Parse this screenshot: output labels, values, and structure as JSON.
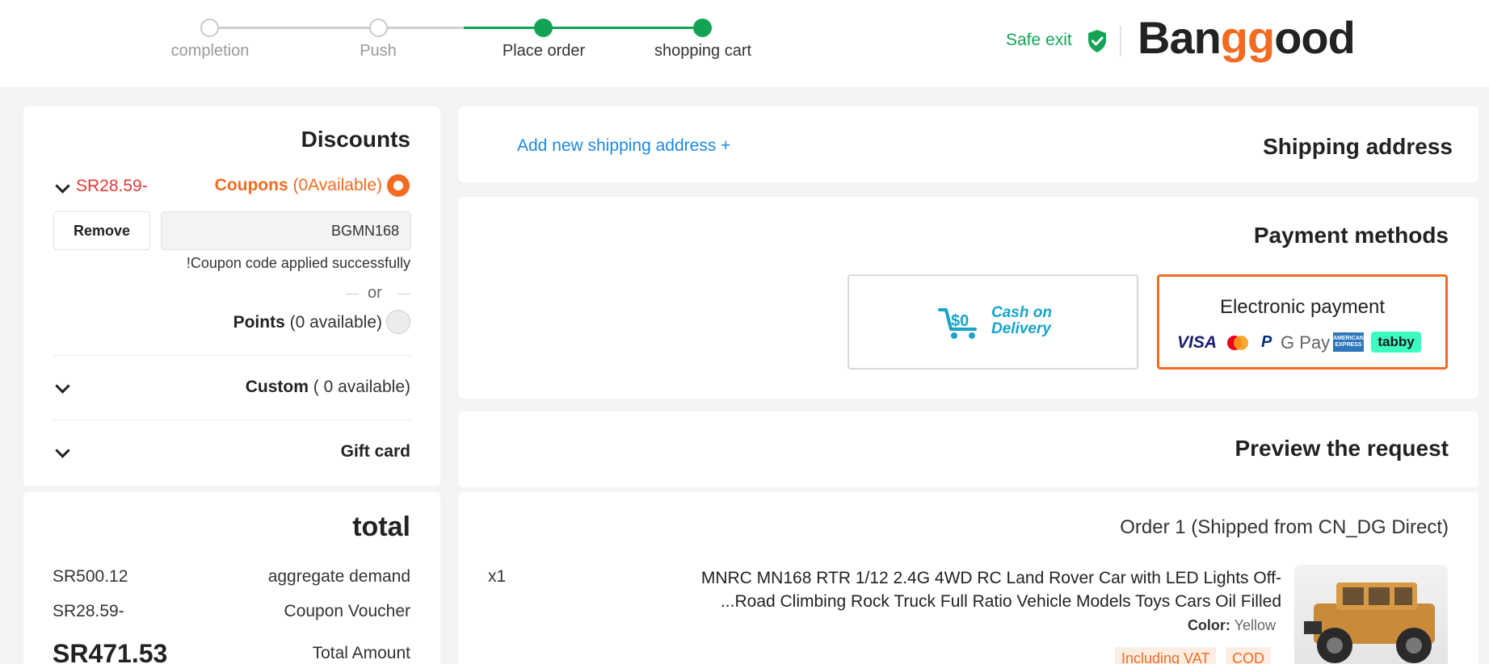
{
  "header": {
    "steps": [
      {
        "label": "completion",
        "active": false
      },
      {
        "label": "Push",
        "active": false
      },
      {
        "label": "Place order",
        "active": true
      },
      {
        "label": "shopping cart",
        "active": true
      }
    ],
    "safe_exit": "Safe exit",
    "logo": {
      "part1": "Ban",
      "part2": "gg",
      "part3": "ood"
    }
  },
  "discounts": {
    "title": "Discounts",
    "coupons": {
      "amount": "SR28.59-",
      "label": "Coupons",
      "available": "(0Available)",
      "selected": true
    },
    "remove_label": "Remove",
    "code_value": "BGMN168",
    "success_msg": "!Coupon code applied successfully",
    "or_label": "or",
    "points": {
      "label": "Points",
      "available": "(0 available)",
      "selected": false
    },
    "custom": {
      "label": "Custom",
      "available": "( 0 available)"
    },
    "gift_card": {
      "label": "Gift card"
    }
  },
  "total": {
    "title": "total",
    "rows": [
      {
        "value": "SR500.12",
        "label": "aggregate demand"
      },
      {
        "value": "SR28.59-",
        "label": "Coupon Voucher"
      },
      {
        "value": "SR471.53",
        "label": "Total Amount"
      }
    ]
  },
  "shipping": {
    "title": "Shipping address",
    "add_link": "Add new shipping address +"
  },
  "payment": {
    "title": "Payment methods",
    "cod": {
      "line1": "Cash on",
      "line2": "Delivery"
    },
    "electronic": {
      "label": "Electronic payment",
      "brands": [
        "VISA",
        "P",
        "G Pay",
        "AMERICAN EXPRESS",
        "tabby"
      ]
    }
  },
  "preview": {
    "title": "Preview the request"
  },
  "order": {
    "heading": "Order 1 (Shipped from CN_DG Direct)",
    "qty": "x1",
    "product_line1": "MNRC MN168 RTR 1/12 2.4G 4WD RC Land Rover Car with LED Lights Off-",
    "product_line2": "...Road Climbing Rock Truck Full Ratio Vehicle Models Toys Cars Oil Filled",
    "color_label": "Color:",
    "color_value": "Yellow",
    "tags": [
      "Including VAT",
      "COD"
    ]
  },
  "colors": {
    "accent": "#f26b21",
    "green": "#12a454",
    "link": "#1e88e5"
  },
  "icons": [
    "shield-check-icon",
    "chevron-down-icon",
    "cart-icon",
    "mastercard-icon"
  ]
}
